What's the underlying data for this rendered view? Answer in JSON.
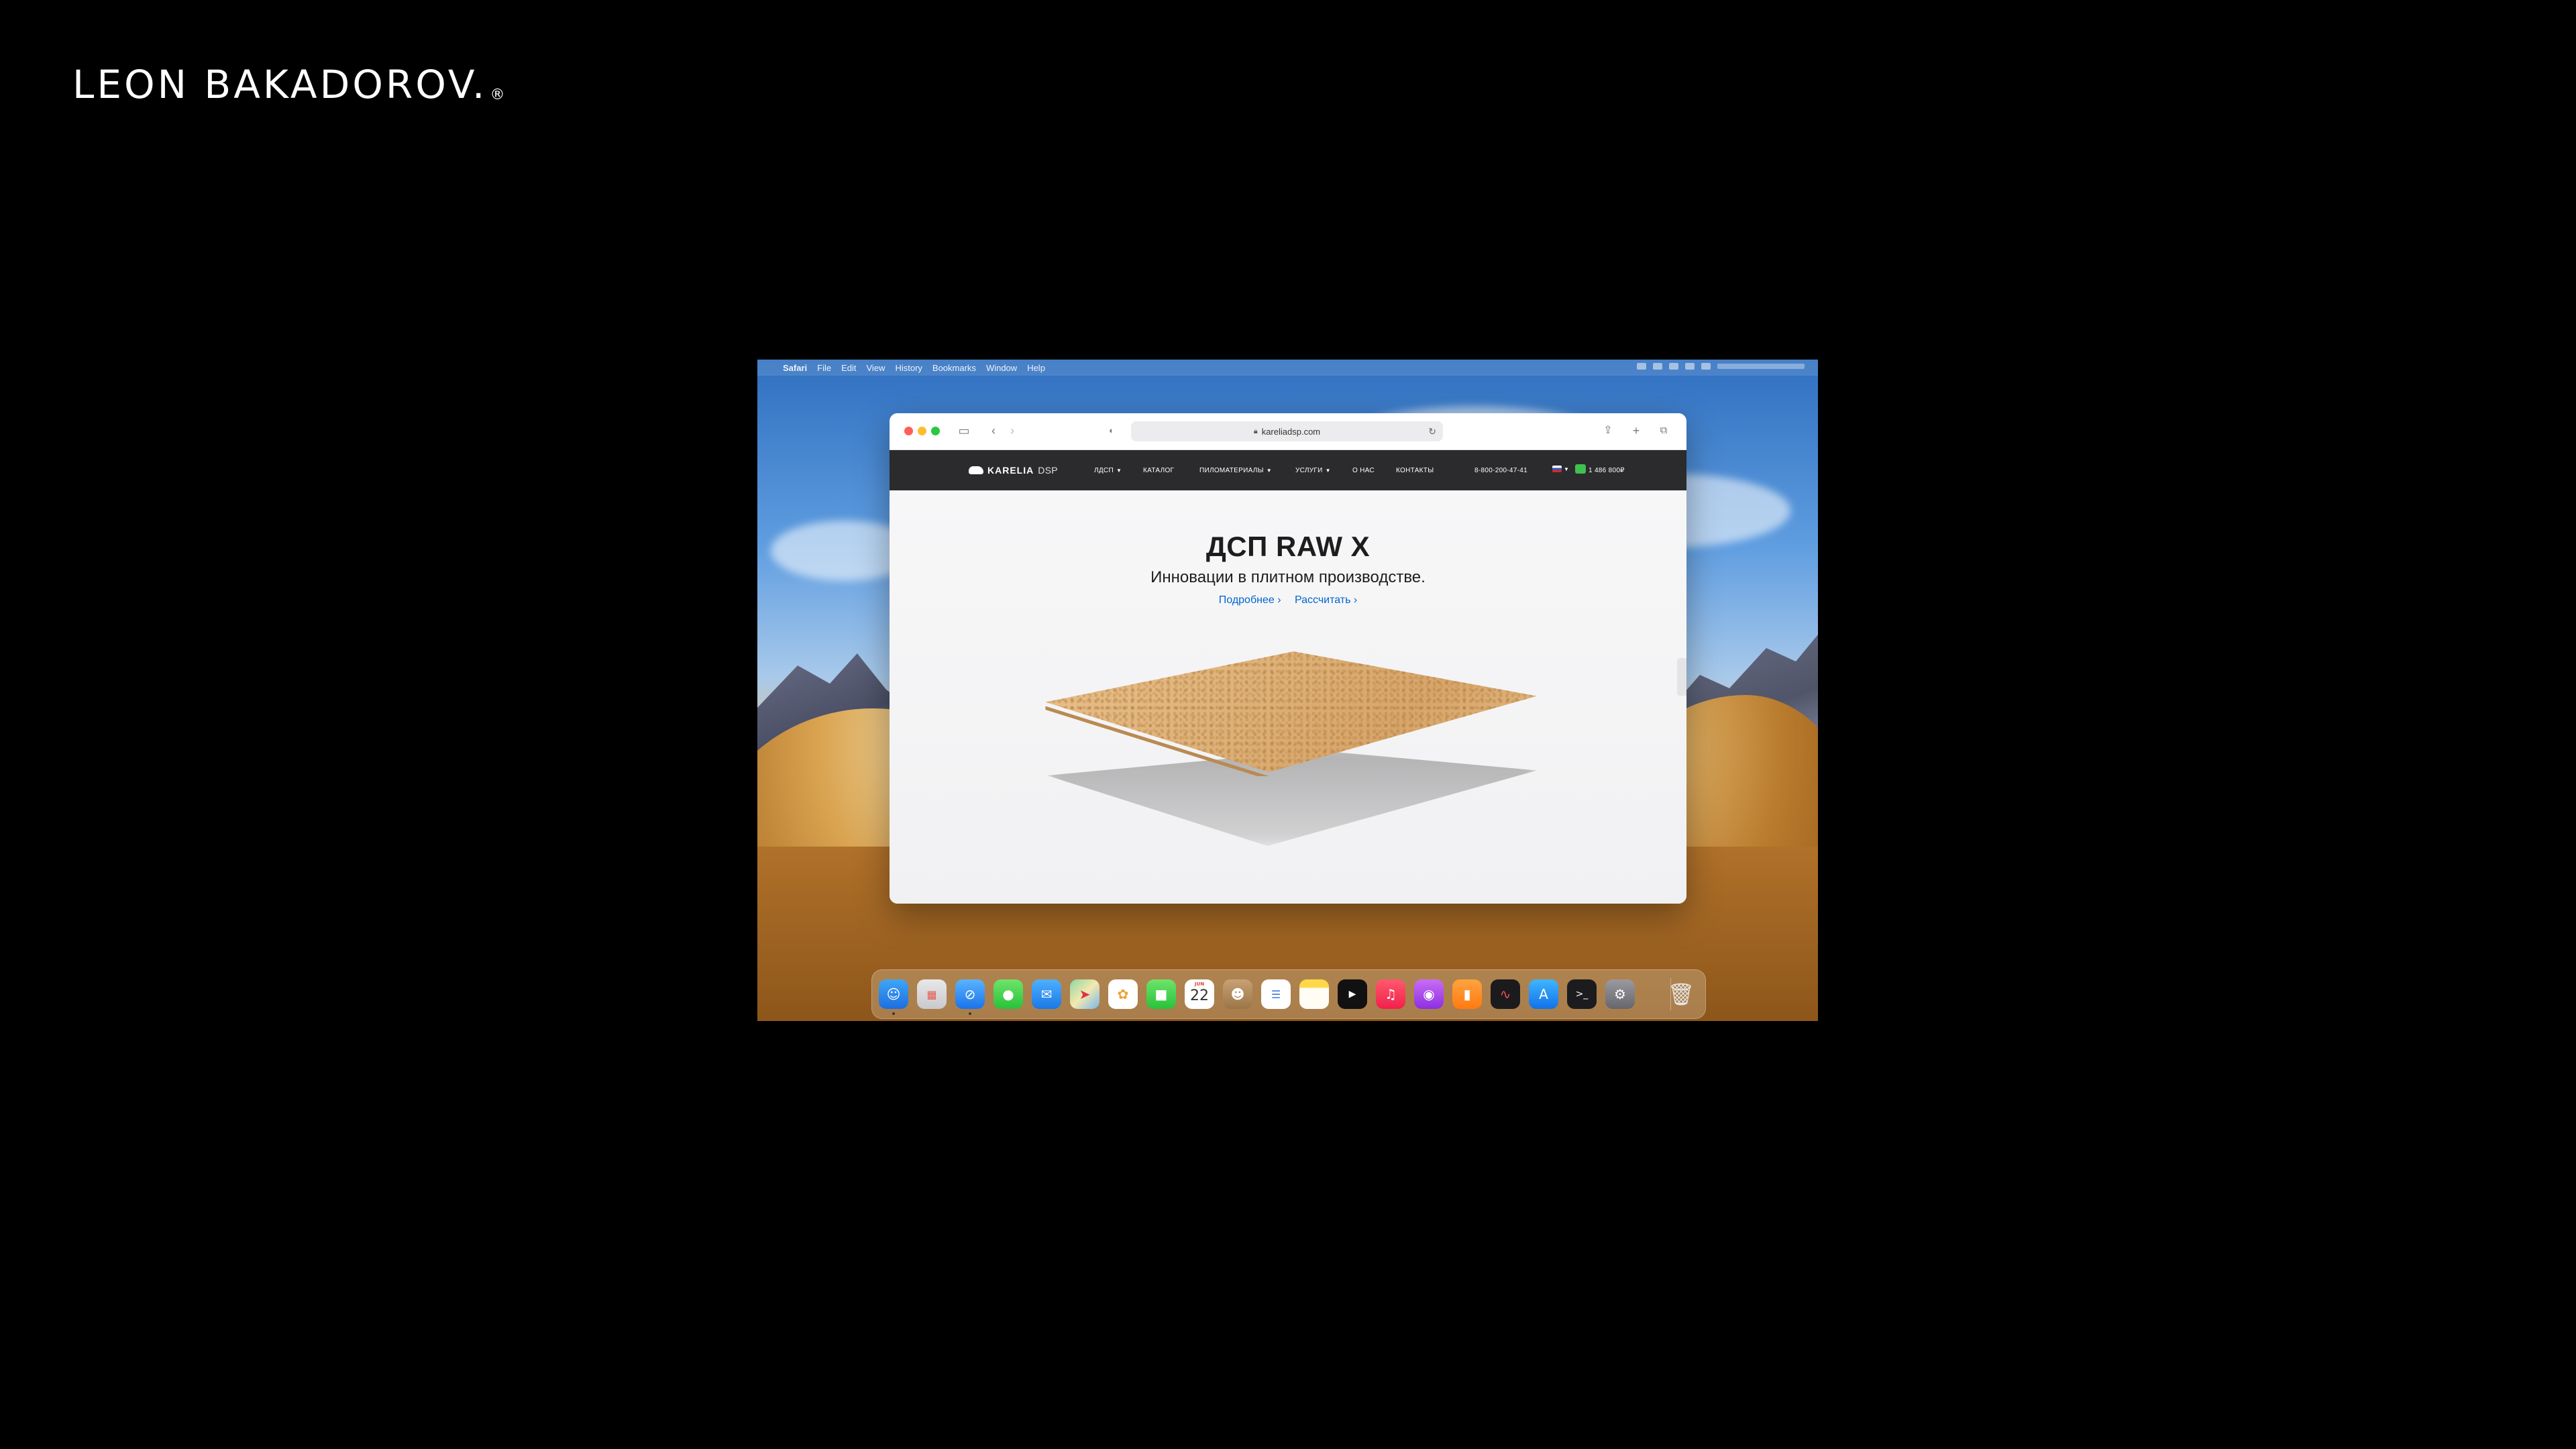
{
  "brand": {
    "name": "LEON BAKADOROV.",
    "mark": "®"
  },
  "menubar": {
    "apple_icon": "apple-icon",
    "items": [
      "Safari",
      "File",
      "Edit",
      "View",
      "History",
      "Bookmarks",
      "Window",
      "Help"
    ]
  },
  "safari": {
    "url": "kareliadsp.com",
    "lock_icon": "lock-icon"
  },
  "site": {
    "logo_main": "KARELIA",
    "logo_sub": "DSP",
    "nav": [
      "ЛДСП",
      "КАТАЛОГ",
      "ПИЛОМАТЕРИАЛЫ",
      "УСЛУГИ",
      "О НАС",
      "КОНТАКТЫ"
    ],
    "phone": "8-800-200-47-41",
    "cart_total": "1 486 800₽"
  },
  "hero": {
    "title": "ДСП RAW X",
    "subtitle": "Инновации в плитном производстве.",
    "link_more": "Подробнее ›",
    "link_calc": "Рассчитать ›"
  },
  "dock": {
    "calendar_month": "JUN",
    "calendar_day": "22",
    "apps": [
      "Finder",
      "Launchpad",
      "Safari",
      "Messages",
      "Mail",
      "Maps",
      "Photos",
      "FaceTime",
      "Calendar",
      "Contacts",
      "Reminders",
      "Notes",
      "TV",
      "Music",
      "Podcasts",
      "Books",
      "Voice Memos",
      "App Store",
      "Terminal",
      "System Preferences",
      "Trash"
    ]
  },
  "colors": {
    "site_nav_bg": "#2b2b2d",
    "link": "#0066cc",
    "board": "#ddb27a"
  }
}
